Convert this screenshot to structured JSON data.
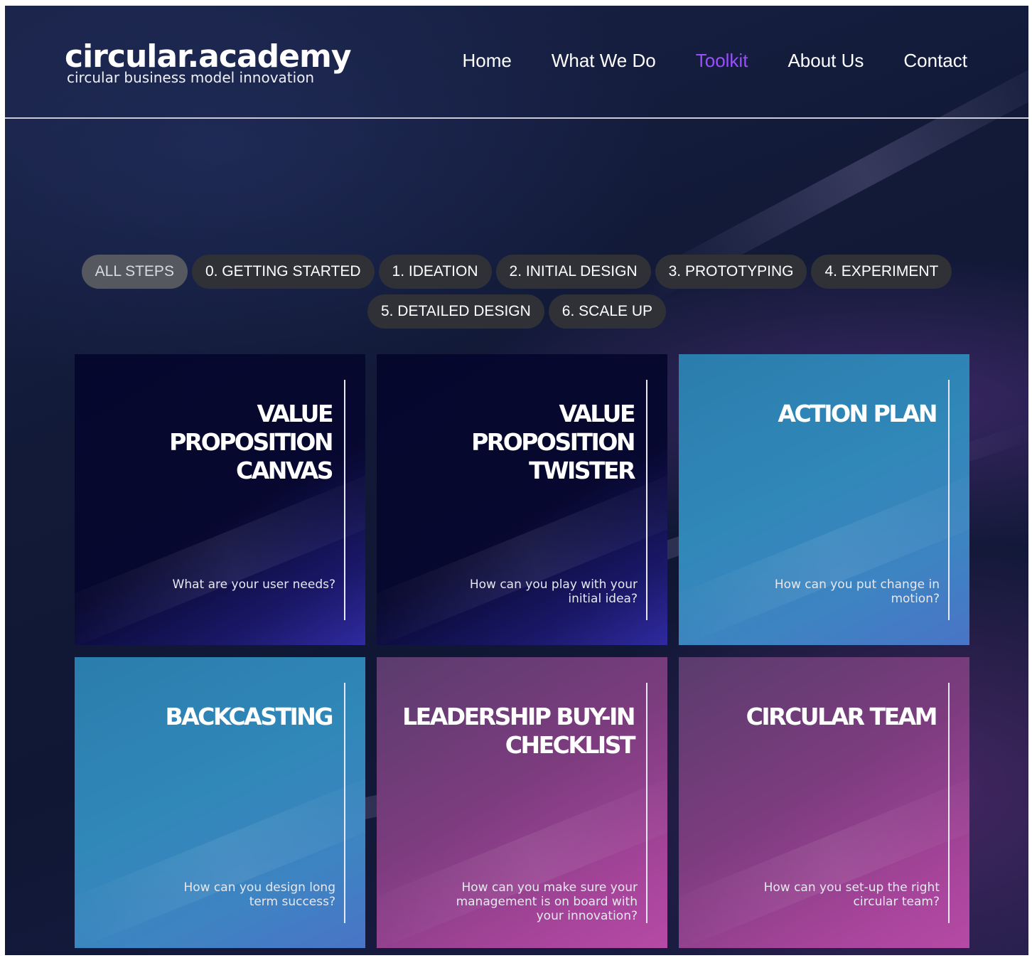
{
  "header": {
    "logo_title": "circular.academy",
    "logo_subtitle": "circular business model innovation",
    "nav": [
      {
        "label": "Home",
        "active": false
      },
      {
        "label": "What We Do",
        "active": false
      },
      {
        "label": "Toolkit",
        "active": true
      },
      {
        "label": "About Us",
        "active": false
      },
      {
        "label": "Contact",
        "active": false
      }
    ]
  },
  "filters": {
    "row1": [
      "ALL STEPS",
      "0. GETTING STARTED",
      "1. IDEATION",
      "2. INITIAL DESIGN",
      "3. PROTOTYPING",
      "4. EXPERIMENT"
    ],
    "row2": [
      "5. DETAILED DESIGN",
      "6. SCALE UP"
    ],
    "active": "ALL STEPS"
  },
  "cards": [
    {
      "title_line1": "VALUE PROPOSITION",
      "title_line2": "CANVAS",
      "description": "What are your user needs?",
      "theme": "navy"
    },
    {
      "title_line1": "VALUE PROPOSITION",
      "title_line2": "TWISTER",
      "description": "How can you play with your initial idea?",
      "theme": "navy"
    },
    {
      "title_line1": "ACTION PLAN",
      "title_line2": "",
      "description": "How can you put change in motion?",
      "theme": "blue"
    },
    {
      "title_line1": "BACKCASTING",
      "title_line2": "",
      "description": "How can you design long term success?",
      "theme": "blue"
    },
    {
      "title_line1": "LEADERSHIP BUY-IN",
      "title_line2": "CHECKLIST",
      "description": "How can you make sure your management is on board with your innovation?",
      "theme": "purple"
    },
    {
      "title_line1": "CIRCULAR TEAM",
      "title_line2": "",
      "description": "How can you set-up the right circular team?",
      "theme": "purple"
    }
  ],
  "colors": {
    "nav_active": "#9b4dff",
    "pill_bg": "#2f3137",
    "pill_active_bg": "#55585e"
  }
}
